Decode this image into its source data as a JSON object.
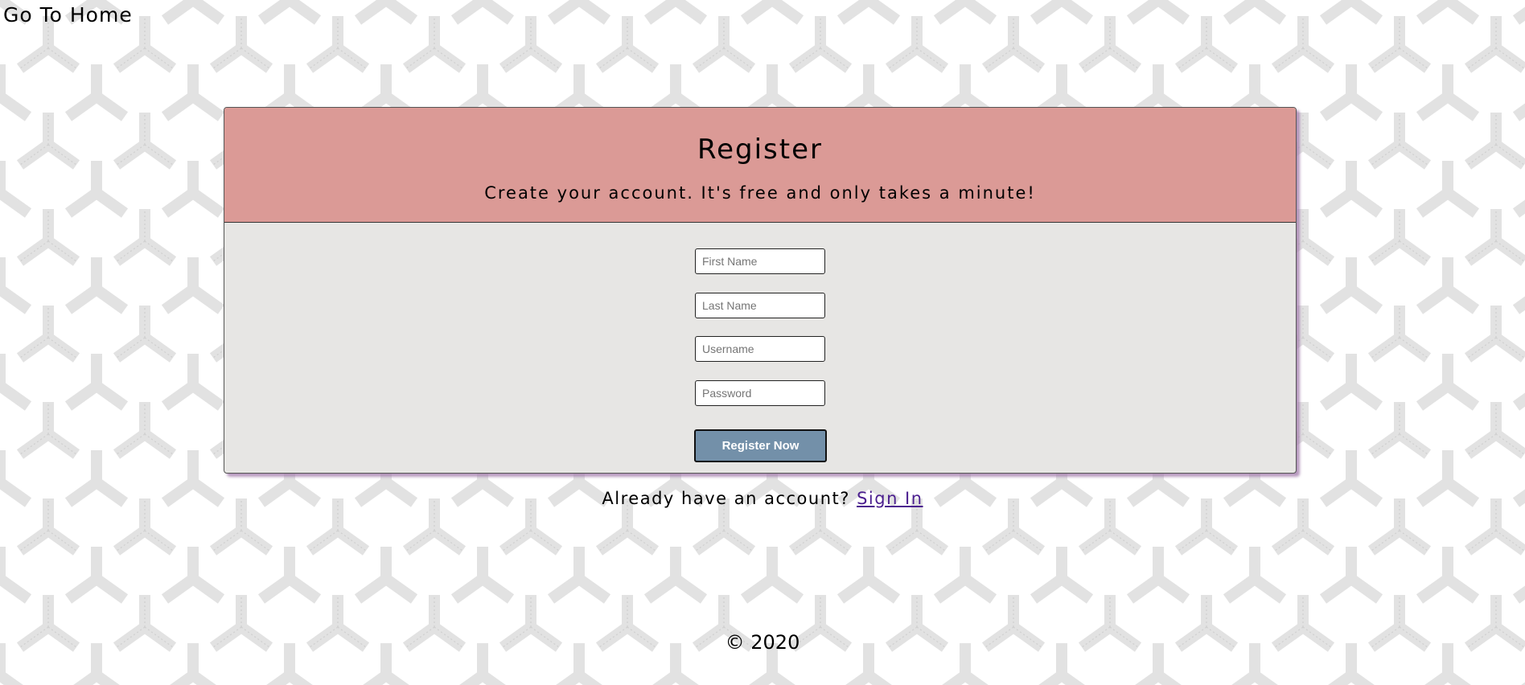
{
  "nav": {
    "home_link": "Go To Home"
  },
  "card": {
    "title": "Register",
    "subtitle": "Create your account. It's free and only takes a minute!"
  },
  "form": {
    "first_name_placeholder": "First Name",
    "last_name_placeholder": "Last Name",
    "username_placeholder": "Username",
    "password_placeholder": "Password",
    "submit_label": "Register Now"
  },
  "signin": {
    "prompt": "Already have an account?",
    "link_label": "Sign In"
  },
  "footer": {
    "copyright": "© 2020"
  },
  "colors": {
    "header_bg": "#db9a96",
    "card_bg": "#e7e6e4",
    "button_bg": "#7390a9",
    "link": "#4b1f8f",
    "pattern_stroke": "#e3e3e3"
  }
}
